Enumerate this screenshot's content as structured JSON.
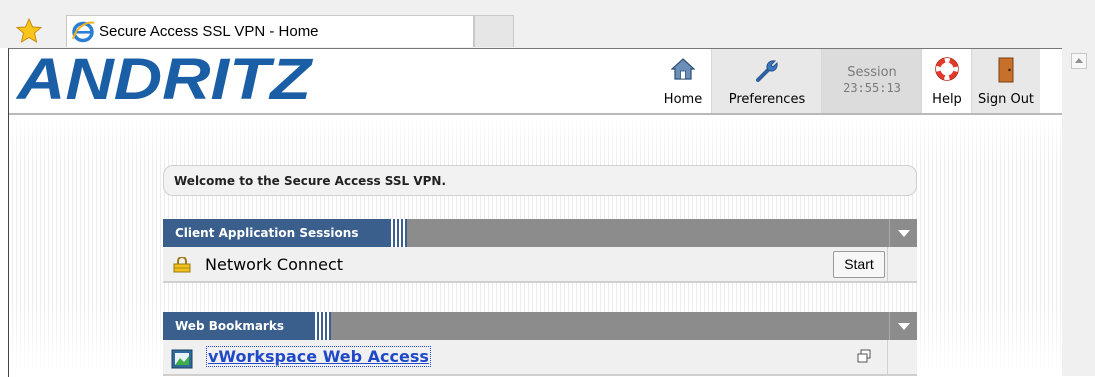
{
  "browser": {
    "tab_title": "Secure Access SSL VPN - Home",
    "icons": {
      "favorites": "star-icon",
      "tab_favicon": "internet-explorer-icon"
    }
  },
  "header": {
    "logo_text": "ANDRITZ",
    "brand_color": "#1a5ea6",
    "nav": {
      "home": "Home",
      "preferences": "Preferences",
      "session_label": "Session",
      "session_time": "23:55:13",
      "help": "Help",
      "sign_out": "Sign Out"
    }
  },
  "welcome_message": "Welcome to the Secure Access SSL VPN.",
  "client_sessions": {
    "title": "Client Application Sessions",
    "items": [
      {
        "label": "Network Connect",
        "button": "Start",
        "icon": "lock-icon"
      }
    ]
  },
  "web_bookmarks": {
    "title": "Web Bookmarks",
    "items": [
      {
        "label": "vWorkspace Web Access",
        "icon": "bookmark-page-icon",
        "action_icon": "open-new-window-icon"
      }
    ]
  },
  "colors": {
    "panel_title_bg": "#3a5f8c",
    "panel_bar_bg": "#8c8c8c",
    "link": "#1f49c8"
  }
}
